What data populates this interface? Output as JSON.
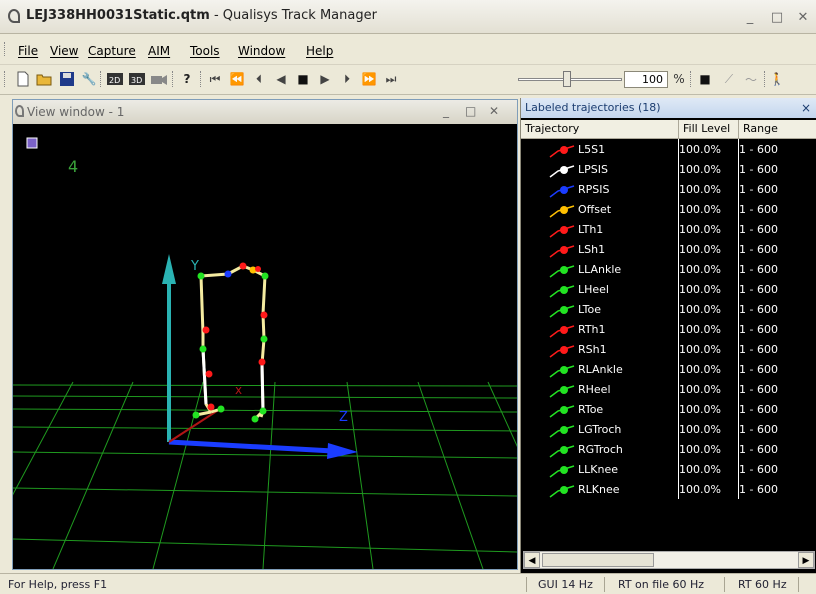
{
  "window": {
    "title_file": "LEJ338HH0031Static.qtm",
    "title_app": " - Qualisys Track Manager",
    "minimize": "_",
    "maximize": "□",
    "close": "✕"
  },
  "menu": [
    "File",
    "View",
    "Capture",
    "AIM",
    "Tools",
    "Window",
    "Help"
  ],
  "toolbar": {
    "zoom_value": "100",
    "zoom_unit": "%"
  },
  "view_window": {
    "title": "View window - 1",
    "frame_label": "4",
    "axis_y": "Y",
    "axis_x": "x",
    "axis_z": "Z",
    "minimize": "_",
    "maximize": "□",
    "close": "✕"
  },
  "trajectories": {
    "title": "Labeled trajectories (18)",
    "close": "×",
    "columns": [
      "Trajectory",
      "Fill Level",
      "Range"
    ],
    "rows": [
      {
        "name": "L5S1",
        "fill": "100.0%",
        "range": "1 - 600",
        "color": "#ff1a1a"
      },
      {
        "name": "LPSIS",
        "fill": "100.0%",
        "range": "1 - 600",
        "color": "#ffffff"
      },
      {
        "name": "RPSIS",
        "fill": "100.0%",
        "range": "1 - 600",
        "color": "#1a3cff"
      },
      {
        "name": "Offset",
        "fill": "100.0%",
        "range": "1 - 600",
        "color": "#ffc000"
      },
      {
        "name": "LTh1",
        "fill": "100.0%",
        "range": "1 - 600",
        "color": "#ff1a1a"
      },
      {
        "name": "LSh1",
        "fill": "100.0%",
        "range": "1 - 600",
        "color": "#ff1a1a"
      },
      {
        "name": "LLAnkle",
        "fill": "100.0%",
        "range": "1 - 600",
        "color": "#22e322"
      },
      {
        "name": "LHeel",
        "fill": "100.0%",
        "range": "1 - 600",
        "color": "#22e322"
      },
      {
        "name": "LToe",
        "fill": "100.0%",
        "range": "1 - 600",
        "color": "#22e322"
      },
      {
        "name": "RTh1",
        "fill": "100.0%",
        "range": "1 - 600",
        "color": "#ff1a1a"
      },
      {
        "name": "RSh1",
        "fill": "100.0%",
        "range": "1 - 600",
        "color": "#ff1a1a"
      },
      {
        "name": "RLAnkle",
        "fill": "100.0%",
        "range": "1 - 600",
        "color": "#22e322"
      },
      {
        "name": "RHeel",
        "fill": "100.0%",
        "range": "1 - 600",
        "color": "#22e322"
      },
      {
        "name": "RToe",
        "fill": "100.0%",
        "range": "1 - 600",
        "color": "#22e322"
      },
      {
        "name": "LGTroch",
        "fill": "100.0%",
        "range": "1 - 600",
        "color": "#22e322"
      },
      {
        "name": "RGTroch",
        "fill": "100.0%",
        "range": "1 - 600",
        "color": "#22e322"
      },
      {
        "name": "LLKnee",
        "fill": "100.0%",
        "range": "1 - 600",
        "color": "#22e322"
      },
      {
        "name": "RLKnee",
        "fill": "100.0%",
        "range": "1 - 600",
        "color": "#22e322"
      }
    ]
  },
  "status": {
    "help": "For Help, press F1",
    "gui": "GUI 14 Hz",
    "rt_file": "RT on file 60 Hz",
    "rt": "RT 60 Hz"
  }
}
